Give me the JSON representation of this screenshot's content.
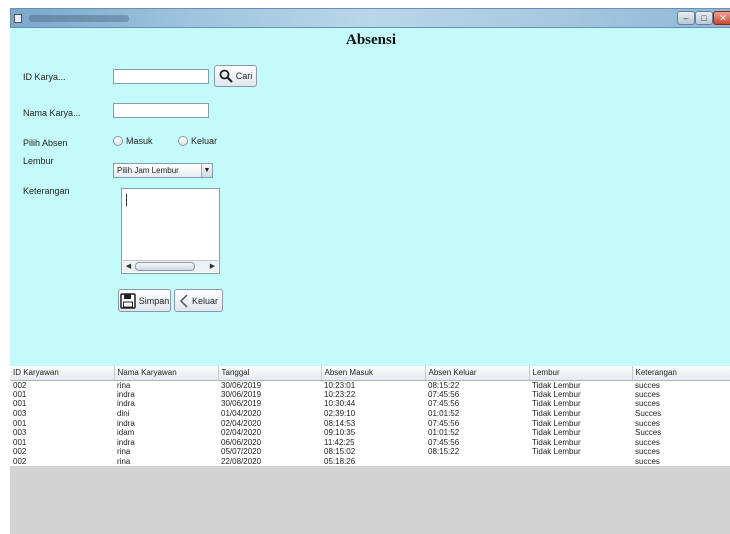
{
  "form": {
    "title": "Absensi",
    "id_label": "ID Karya...",
    "id_value": "",
    "search_button": "Cari",
    "name_label": "Nama Karya...",
    "name_value": "",
    "absen_label": "Pilih Absen",
    "radio_masuk": "Masuk",
    "radio_keluar": "Keluar",
    "lembur_label": "Lembur",
    "lembur_select": "Pilih Jam Lembur",
    "keterangan_label": "Keterangan",
    "keterangan_value": "",
    "save_button": "Simpan",
    "exit_button": "Keluar"
  },
  "table": {
    "headers": [
      "ID Karyawan",
      "Nama Karyawan",
      "Tanggal",
      "Absen Masuk",
      "Absen Keluar",
      "Lembur",
      "Keterangan"
    ],
    "rows": [
      [
        "002",
        "rina",
        "30/06/2019",
        "10:23:01",
        "08:15:22",
        "Tidak Lembur",
        "succes"
      ],
      [
        "001",
        "indra",
        "30/06/2019",
        "10:23:22",
        "07:45:56",
        "Tidak Lembur",
        "succes"
      ],
      [
        "001",
        "indra",
        "30/06/2019",
        "10:30:44",
        "07:45:56",
        "Tidak Lembur",
        "succes"
      ],
      [
        "003",
        "dini",
        "01/04/2020",
        "02:39:10",
        "01:01:52",
        "Tidak Lembur",
        "Succes"
      ],
      [
        "001",
        "indra",
        "02/04/2020",
        "08:14:53",
        "07:45:56",
        "Tidak Lembur",
        "succes"
      ],
      [
        "003",
        "idam",
        "02/04/2020",
        "09:10:35",
        "01:01:52",
        "Tidak Lembur",
        "Succes"
      ],
      [
        "001",
        "indra",
        "06/06/2020",
        "11:42:25",
        "07:45:56",
        "Tidak Lembur",
        "succes"
      ],
      [
        "002",
        "rina",
        "05/07/2020",
        "08:15:02",
        "08:15:22",
        "Tidak Lembur",
        "succes"
      ],
      [
        "002",
        "rina",
        "22/08/2020",
        "05:18:26",
        "",
        "",
        "succes"
      ]
    ]
  },
  "colors": {
    "panel_bg": "#c4fbfa",
    "table_area_bg": "#d3d3d3"
  },
  "icons": {
    "search": "magnifier-icon",
    "save": "floppy-disk-icon",
    "exit": "chevron-left-icon"
  }
}
